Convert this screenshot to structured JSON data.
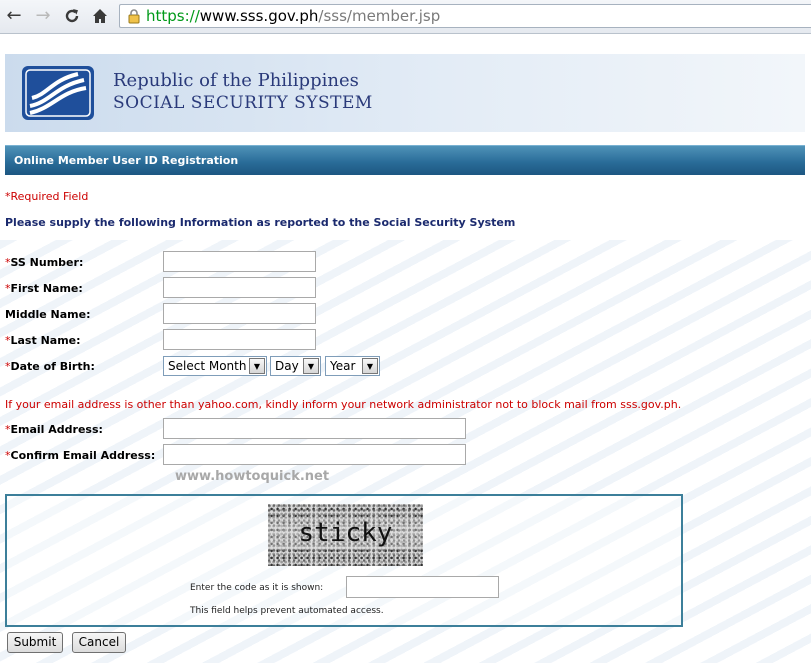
{
  "browser": {
    "back_icon": "back-arrow-icon",
    "forward_icon": "forward-arrow-icon",
    "reload_icon": "reload-icon",
    "home_icon": "home-icon",
    "lock_icon": "lock-icon",
    "url_scheme": "https://",
    "url_host": "www.sss.gov.ph",
    "url_path": "/sss/member.jsp"
  },
  "header": {
    "line1": "Republic of the Philippines",
    "line2": "SOCIAL SECURITY SYSTEM"
  },
  "form": {
    "title": "Online Member User ID Registration",
    "required_note": "*Required Field",
    "instruction": "Please supply the following Information as reported to the Social Security System",
    "required_marker": "*",
    "fields": {
      "ss_number": "SS Number:",
      "first_name": "First Name:",
      "middle_name": "Middle Name:",
      "last_name": "Last Name:",
      "dob": "Date of Birth:",
      "email": "Email Address:",
      "confirm_email": "Confirm Email Address:"
    },
    "dob_selects": {
      "month": "Select Month",
      "day": "Day",
      "year": "Year"
    },
    "email_note": "If your email address is other than yahoo.com, kindly inform your network administrator not to block mail from sss.gov.ph.",
    "watermark_text": "www.howtoquick.net",
    "captcha": {
      "word": "sticky",
      "label": "Enter the code as it is shown:",
      "help": "This field helps prevent automated access."
    },
    "buttons": {
      "submit": "Submit",
      "cancel": "Cancel"
    }
  },
  "colors": {
    "title_bar": "#2a6d99",
    "required": "#cc0000",
    "heading_text": "#1b2a6e",
    "url_scheme": "#009a19",
    "logo_blue": "#1f4f9b"
  }
}
